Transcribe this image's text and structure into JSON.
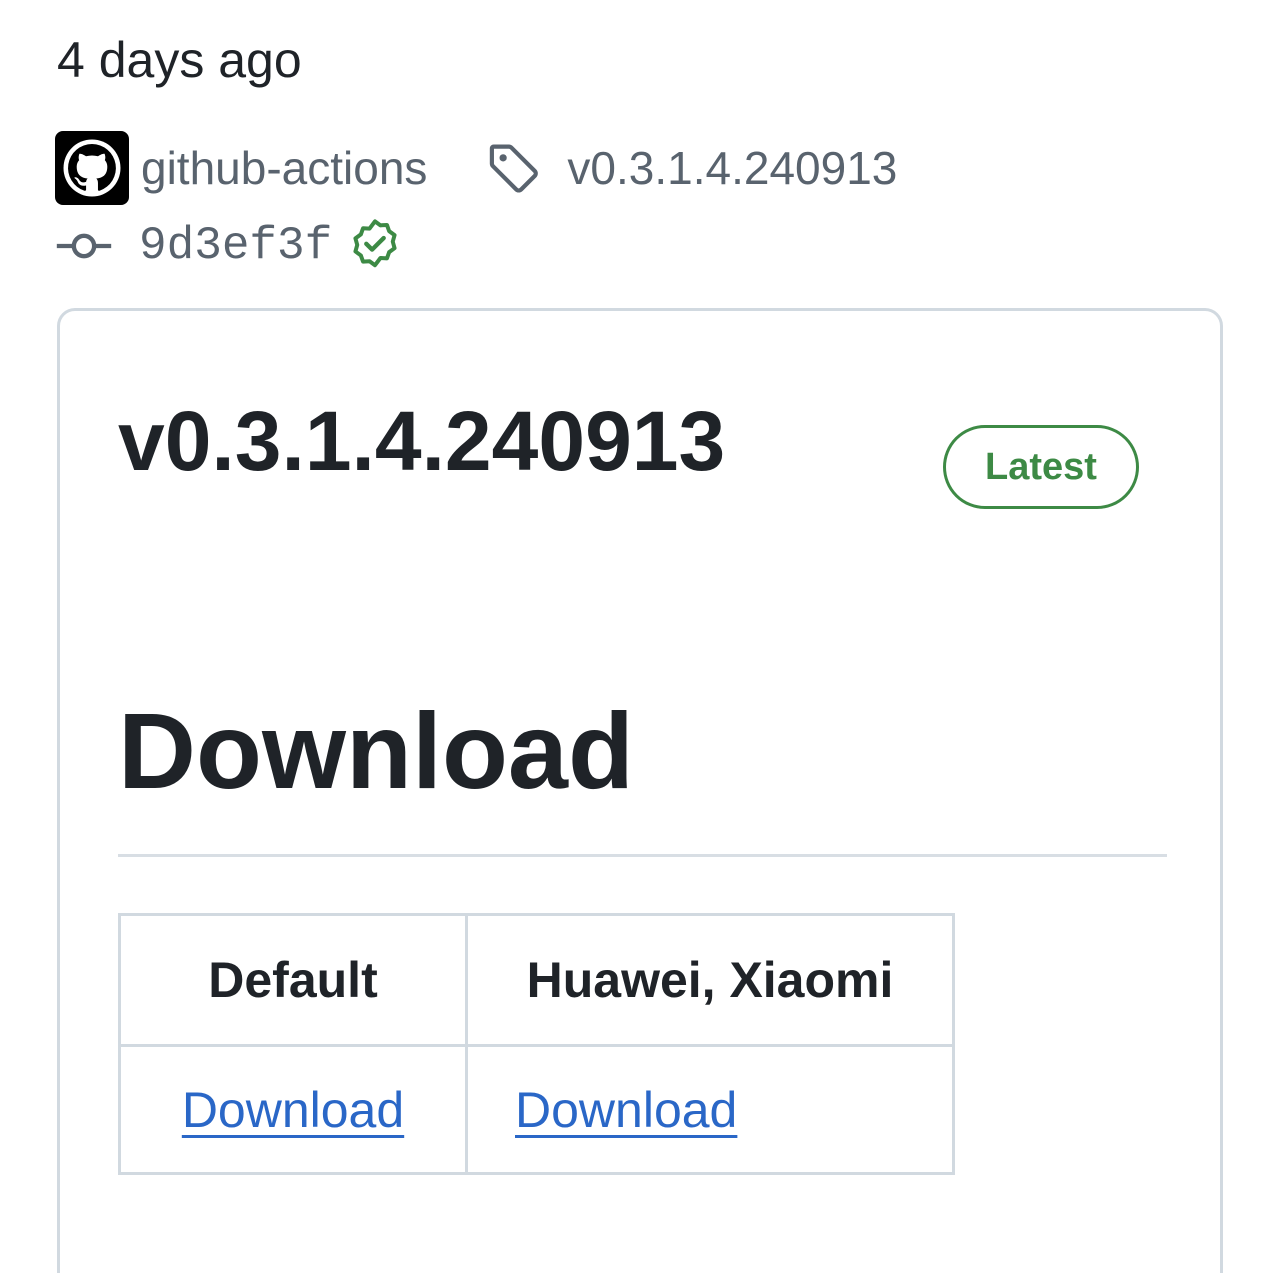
{
  "release": {
    "relative_time": "4 days ago",
    "author": "github-actions",
    "tag": "v0.3.1.4.240913",
    "commit": "9d3ef3f",
    "title": "v0.3.1.4.240913",
    "badge": "Latest"
  },
  "body": {
    "heading": "Download",
    "table": {
      "headers": [
        "Default",
        "Huawei, Xiaomi"
      ],
      "rows": [
        [
          "Download",
          "Download"
        ]
      ]
    }
  },
  "icons": {
    "avatar": "github-logo-icon",
    "tag": "tag-icon",
    "commit": "git-commit-icon",
    "verified": "verified-check-icon"
  },
  "colors": {
    "text": "#1f2328",
    "muted": "#59636e",
    "success": "#3d8a45",
    "link": "#2a67c7",
    "border": "#d1d9e0"
  }
}
